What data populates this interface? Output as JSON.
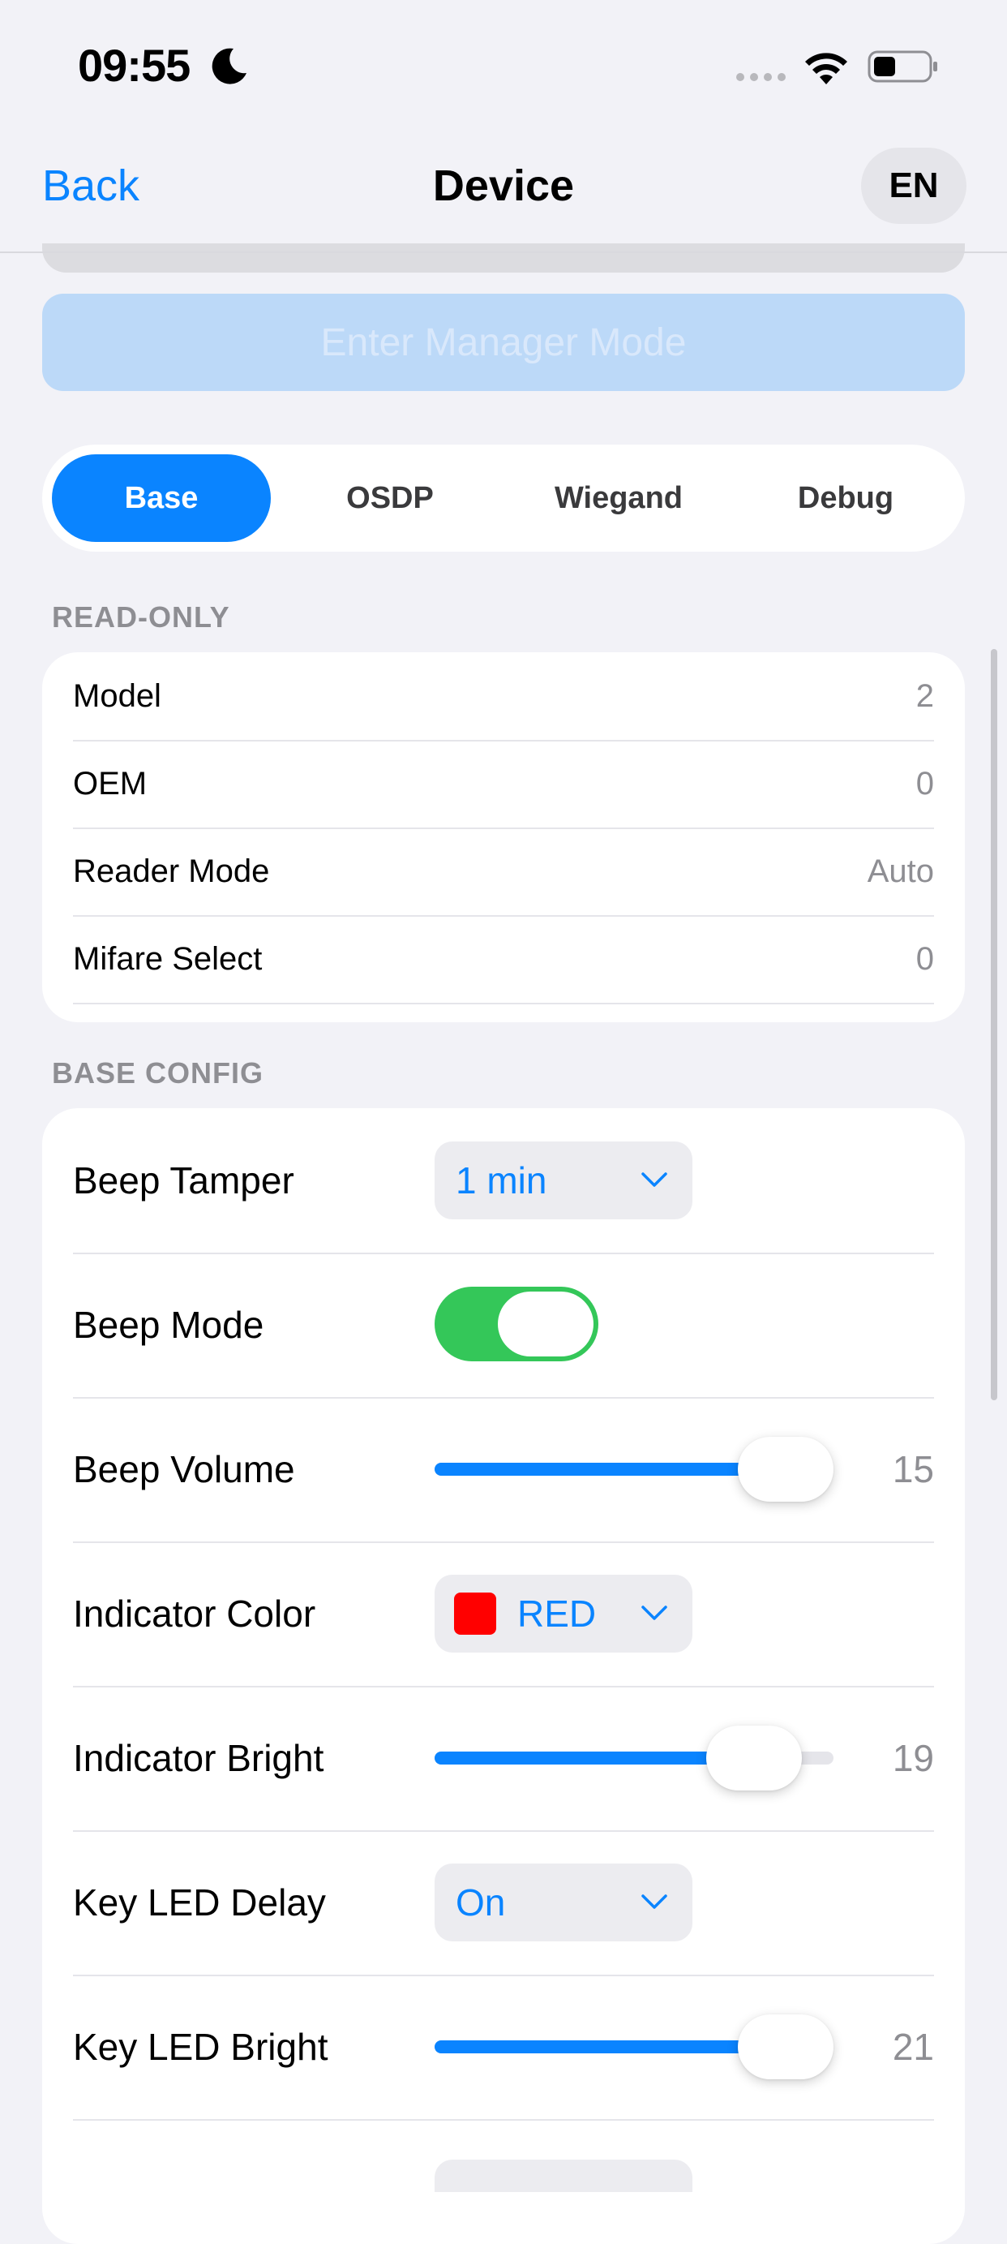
{
  "status_bar": {
    "time": "09:55",
    "icons": [
      "moon-icon",
      "signal-icon",
      "wifi-icon",
      "battery-icon"
    ]
  },
  "nav": {
    "back_label": "Back",
    "title": "Device",
    "language": "EN"
  },
  "manager_button": {
    "label": "Enter Manager Mode",
    "enabled": false
  },
  "tabs": [
    {
      "label": "Base",
      "active": true
    },
    {
      "label": "OSDP",
      "active": false
    },
    {
      "label": "Wiegand",
      "active": false
    },
    {
      "label": "Debug",
      "active": false
    }
  ],
  "read_only": {
    "header": "READ-ONLY",
    "rows": [
      {
        "label": "Model",
        "value": "2"
      },
      {
        "label": "OEM",
        "value": "0"
      },
      {
        "label": "Reader Mode",
        "value": "Auto"
      },
      {
        "label": "Mifare Select",
        "value": "0"
      }
    ]
  },
  "base_config": {
    "header": "BASE CONFIG",
    "beep_tamper": {
      "label": "Beep Tamper",
      "value": "1 min"
    },
    "beep_mode": {
      "label": "Beep Mode",
      "on": true
    },
    "beep_volume": {
      "label": "Beep Volume",
      "value": "15",
      "fill_fraction": 0.88
    },
    "indicator_color": {
      "label": "Indicator Color",
      "value": "RED",
      "swatch": "#ff0000"
    },
    "indicator_bright": {
      "label": "Indicator Bright",
      "value": "19",
      "fill_fraction": 0.8
    },
    "key_led_delay": {
      "label": "Key LED Delay",
      "value": "On"
    },
    "key_led_bright": {
      "label": "Key LED Bright",
      "value": "21",
      "fill_fraction": 0.88
    }
  },
  "colors": {
    "accent": "#0a84ff",
    "toggle_on": "#34c759",
    "background": "#f2f2f7"
  }
}
